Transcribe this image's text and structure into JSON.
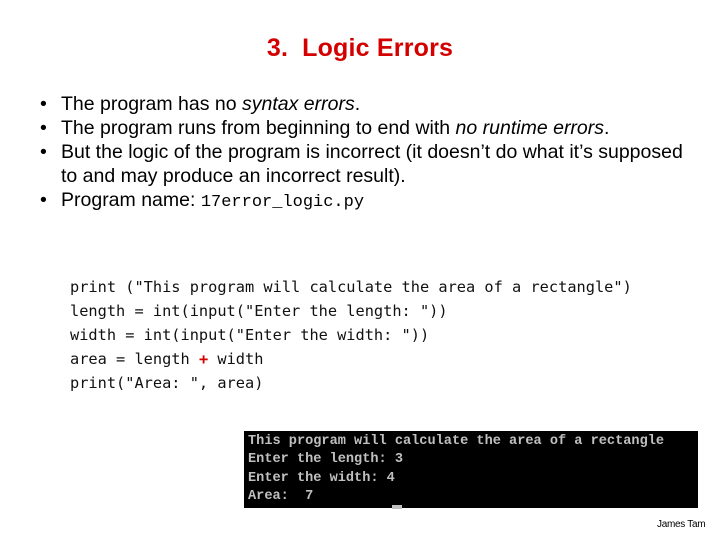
{
  "title": {
    "number": "3.",
    "text": "Logic Errors"
  },
  "bullets": [
    {
      "prefix": "The program has no ",
      "emphasis": "syntax errors",
      "suffix": "."
    },
    {
      "prefix": "The program runs from beginning to end with ",
      "emphasis": "no runtime errors",
      "suffix": "."
    },
    {
      "text": "But the logic of the program is incorrect (it doesn’t do what it’s supposed to and may produce an incorrect result)."
    },
    {
      "label": "Program name: ",
      "filename": "17error_logic.py"
    }
  ],
  "code": {
    "line1": "print (\"This program will calculate the area of a rectangle\")",
    "line2": "length = int(input(\"Enter the length: \"))",
    "line3": "width = int(input(\"Enter the width: \"))",
    "line4_before": "area = length ",
    "line4_operator": "+",
    "line4_after": " width",
    "line5": "print(\"Area: \", area)"
  },
  "console": {
    "lines": [
      "This program will calculate the area of a rectangle",
      "Enter the length: 3",
      "Enter the width: 4",
      "Area:  7"
    ]
  },
  "footer": {
    "author": "James Tam"
  }
}
